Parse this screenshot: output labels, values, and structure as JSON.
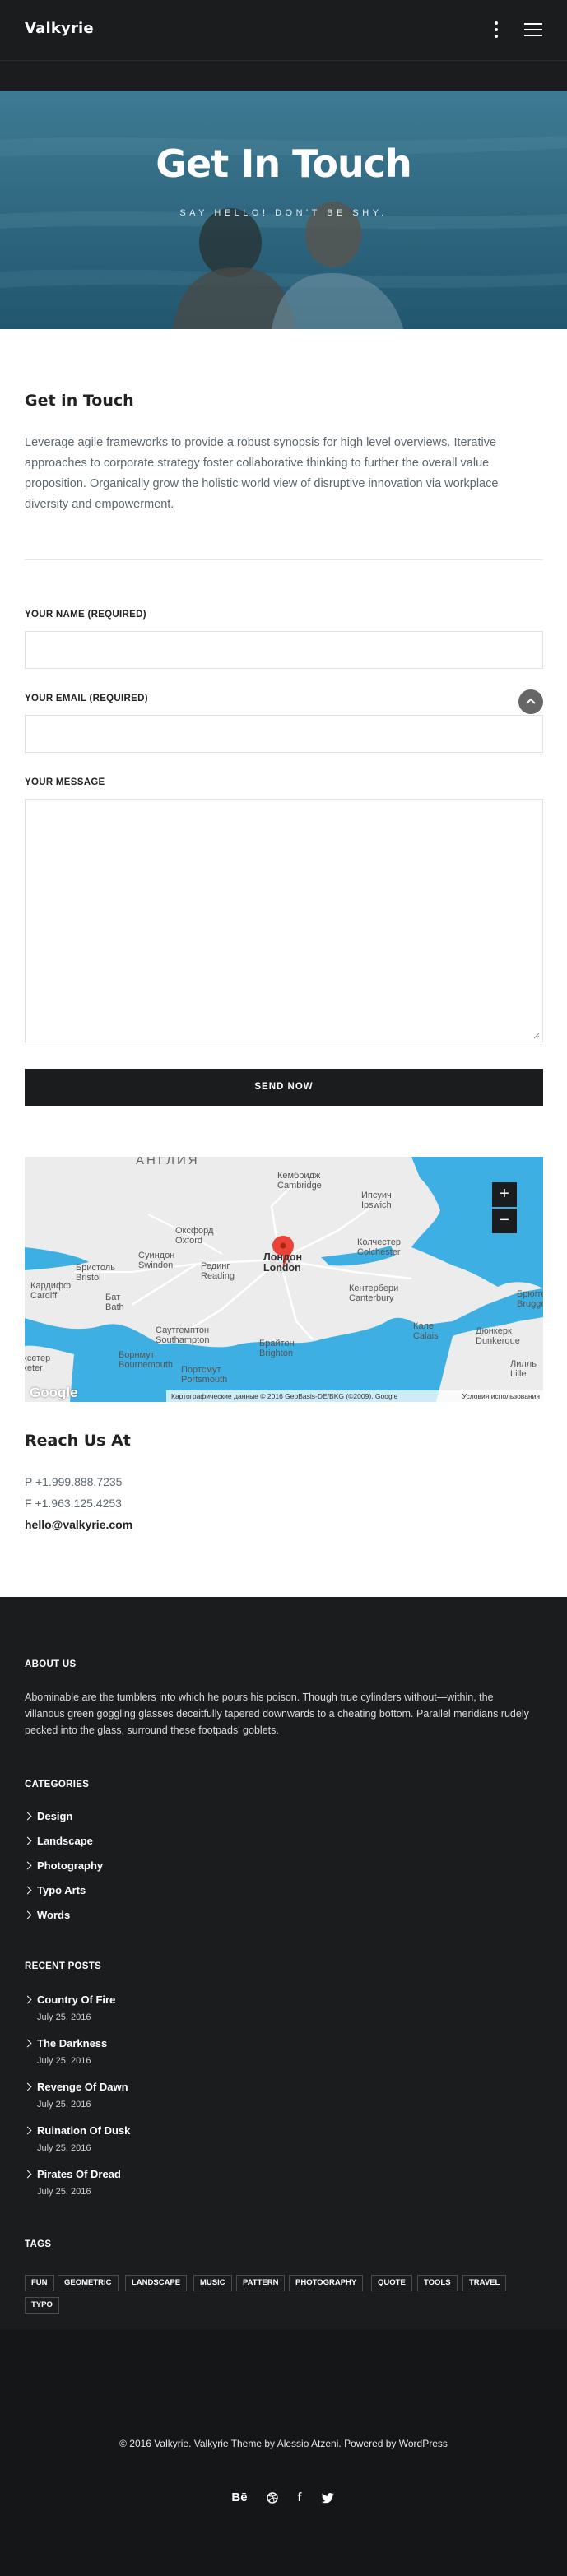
{
  "header": {
    "logo": "Valkyrie",
    "icons": [
      "more-vertical-icon",
      "hamburger-menu-icon"
    ]
  },
  "hero": {
    "title": "Get In Touch",
    "subtitle": "SAY HELLO! DON'T BE SHY."
  },
  "intro": {
    "title": "Get in Touch",
    "text": "Leverage agile frameworks to provide a robust synopsis for high level overviews. Iterative approaches to corporate strategy foster collaborative thinking to further the overall value proposition. Organically grow the holistic world view of disruptive innovation via workplace diversity and empowerment."
  },
  "form": {
    "name_label": "YOUR NAME (REQUIRED)",
    "email_label": "YOUR EMAIL (REQUIRED)",
    "message_label": "YOUR MESSAGE",
    "name_value": "",
    "email_value": "",
    "message_value": "",
    "send_label": "SEND NOW"
  },
  "map": {
    "labels": {
      "england": "АНГЛИЯ",
      "cambridge": "Кембридж\nCambridge",
      "ipswich": "Ипсуич\nIpswich",
      "oxford": "Оксфорд\nOxford",
      "swindon": "Суиндон\nSwindon",
      "reading": "Рединг\nReading",
      "london": "Лондон\nLondon",
      "colchester": "Колчестер\nColchester",
      "bristol": "Бристоль\nBristol",
      "bath": "Бат\nBath",
      "cardiff": "Кардифф\nCardiff",
      "canterbury": "Кентербери\nCanterbury",
      "southampton": "Саутгемптон\nSouthampton",
      "bournemouth": "Борнмут\nBournemouth",
      "portsmouth": "Портсмут\nPortsmouth",
      "brighton": "Брайтон\nBrighton",
      "calais": "Кале\nCalais",
      "dunkerque": "Дюнкерк\nDunkerque",
      "lille": "Лилль\nLille",
      "brugge": "Брюгге\nBrugge",
      "exeter": "Эксетер\nExeter"
    },
    "zoom_in": "+",
    "zoom_out": "−",
    "google": "Google",
    "attribution": "Картографические данные © 2016 GeoBasis-DE/BKG (©2009), Google",
    "terms": "Условия использования"
  },
  "reach": {
    "title": "Reach Us At",
    "phone": "P +1.999.888.7235",
    "fax": "F +1.963.125.4253",
    "email": "hello@valkyrie.com"
  },
  "footer": {
    "about_title": "ABOUT US",
    "about_text": "Abominable are the tumblers into which he pours his poison. Though true cylinders without—within, the villanous green goggling glasses deceitfully tapered downwards to a cheating bottom. Parallel meridians rudely pecked into the glass, surround these footpads' goblets.",
    "categories_title": "CATEGORIES",
    "categories": [
      "Design",
      "Landscape",
      "Photography",
      "Typo Arts",
      "Words"
    ],
    "recent_title": "RECENT POSTS",
    "posts": [
      {
        "title": "Country Of Fire",
        "date": "July 25, 2016"
      },
      {
        "title": "The Darkness",
        "date": "July 25, 2016"
      },
      {
        "title": "Revenge Of Dawn",
        "date": "July 25, 2016"
      },
      {
        "title": "Ruination Of Dusk",
        "date": "July 25, 2016"
      },
      {
        "title": "Pirates Of Dread",
        "date": "July 25, 2016"
      }
    ],
    "tags_title": "TAGS",
    "tags": [
      "FUN",
      "GEOMETRIC",
      "LANDSCAPE",
      "MUSIC",
      "PATTERN",
      "PHOTOGRAPHY",
      "QUOTE",
      "TOOLS",
      "TRAVEL",
      "TYPO"
    ],
    "copyright": "© 2016 Valkyrie. Valkyrie Theme by Alessio Atzeni. Powered by WordPress",
    "social": [
      {
        "icon": "behance-icon",
        "glyph": "Bē"
      },
      {
        "icon": "dribbble-icon",
        "glyph": ""
      },
      {
        "icon": "facebook-icon",
        "glyph": "f"
      },
      {
        "icon": "twitter-icon",
        "glyph": ""
      }
    ]
  },
  "colors": {
    "dark": "#1b1c1e",
    "darker": "#151618",
    "water": "#3dafe3",
    "pin": "#ea4335"
  }
}
